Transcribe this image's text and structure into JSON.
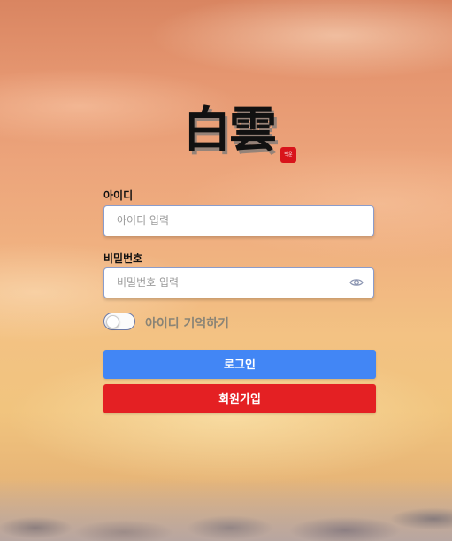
{
  "logo": {
    "title": "白雲",
    "seal_text": "백운"
  },
  "login_form": {
    "id_label": "아이디",
    "id_placeholder": "아이디 입력",
    "id_value": "",
    "password_label": "비밀번호",
    "password_placeholder": "비밀번호 입력",
    "password_value": "",
    "password_visibility_icon": "eye-icon",
    "remember_label": "아이디 기억하기",
    "remember_checked": false,
    "login_button": "로그인",
    "signup_button": "회원가입"
  },
  "colors": {
    "login_button": "#4286f5",
    "signup_button": "#e42023",
    "seal": "#d8141b"
  }
}
